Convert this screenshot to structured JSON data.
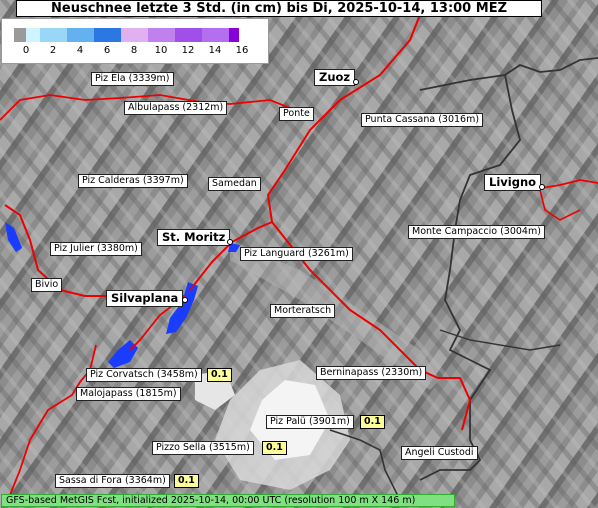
{
  "title": "Neuschnee letzte 3 Std. (in cm) bis Di, 2025-10-14, 13:00 MEZ",
  "legend": {
    "ticks": [
      "0",
      "2",
      "4",
      "6",
      "8",
      "10",
      "12",
      "14",
      "16"
    ],
    "colors": [
      "#9a9a9a",
      "#d0f4ff",
      "#9ad6f5",
      "#63b2ef",
      "#2b78e4",
      "#1246d0",
      "#e0b0f0",
      "#c080ee",
      "#a050e8",
      "#8a00d8"
    ]
  },
  "places": [
    {
      "name": "Piz Ela (3339m)",
      "big": false
    },
    {
      "name": "Zuoz",
      "big": true
    },
    {
      "name": "Albulapass (2312m)",
      "big": false
    },
    {
      "name": "Ponte",
      "big": false
    },
    {
      "name": "Punta Cassana (3016m)",
      "big": false
    },
    {
      "name": "Piz Calderas (3397m)",
      "big": false
    },
    {
      "name": "Samedan",
      "big": false
    },
    {
      "name": "Livigno",
      "big": true
    },
    {
      "name": "Monte Campaccio (3004m)",
      "big": false
    },
    {
      "name": "St. Moritz",
      "big": true
    },
    {
      "name": "Piz Julier (3380m)",
      "big": false
    },
    {
      "name": "Piz Languard (3261m)",
      "big": false
    },
    {
      "name": "Bivio",
      "big": false
    },
    {
      "name": "Silvaplana",
      "big": true
    },
    {
      "name": "Morteratsch",
      "big": false
    },
    {
      "name": "Piz Corvatsch (3458m)",
      "big": false
    },
    {
      "name": "Berninapass (2330m)",
      "big": false
    },
    {
      "name": "Malojapass (1815m)",
      "big": false
    },
    {
      "name": "Piz Palü (3901m)",
      "big": false
    },
    {
      "name": "Pizzo Sella (3515m)",
      "big": false
    },
    {
      "name": "Angeli Custodi",
      "big": false
    },
    {
      "name": "Sassa di Fora (3364m)",
      "big": false
    }
  ],
  "values": [
    "0.1",
    "0.1",
    "0.1",
    "0.1"
  ],
  "footer": "GFS-based MetGIS Fcst, initialized 2025-10-14, 00:00 UTC  (resolution 100 m X 146 m)"
}
